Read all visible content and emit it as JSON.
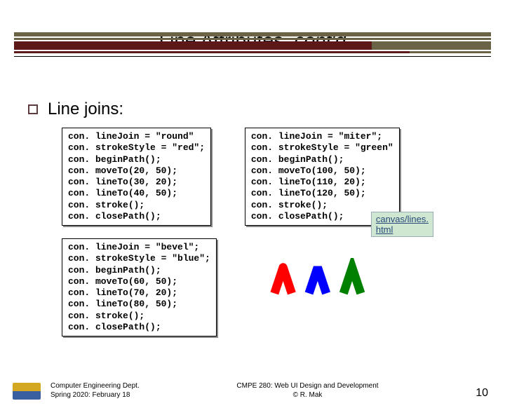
{
  "title": {
    "base": "Line Attributes, ",
    "italic": "cont'd"
  },
  "bullet": "Line joins:",
  "code": {
    "block1": "con. lineJoin = \"round\"\ncon. strokeStyle = \"red\";\ncon. beginPath();\ncon. moveTo(20, 50);\ncon. lineTo(30, 20);\ncon. lineTo(40, 50);\ncon. stroke();\ncon. closePath();",
    "block2": "con. lineJoin = \"bevel\";\ncon. strokeStyle = \"blue\";\ncon. beginPath();\ncon. moveTo(60, 50);\ncon. lineTo(70, 20);\ncon. lineTo(80, 50);\ncon. stroke();\ncon. closePath();",
    "block3": "con. lineJoin = \"miter\";\ncon. strokeStyle = \"green\"\ncon. beginPath();\ncon. moveTo(100, 50);\ncon. lineTo(110, 20);\ncon. lineTo(120, 50);\ncon. stroke();\ncon. closePath();"
  },
  "link_label": "canvas/lines. html",
  "chart_data": {
    "type": "line",
    "description": "Three caret shapes drawn with different lineJoin styles",
    "series": [
      {
        "name": "round",
        "color": "red",
        "points": [
          [
            20,
            50
          ],
          [
            30,
            20
          ],
          [
            40,
            50
          ]
        ]
      },
      {
        "name": "bevel",
        "color": "blue",
        "points": [
          [
            60,
            50
          ],
          [
            70,
            20
          ],
          [
            80,
            50
          ]
        ]
      },
      {
        "name": "miter",
        "color": "green",
        "points": [
          [
            100,
            50
          ],
          [
            110,
            20
          ],
          [
            120,
            50
          ]
        ]
      }
    ],
    "lineWidth": 10,
    "xlim": [
      10,
      130
    ],
    "ylim": [
      10,
      60
    ]
  },
  "footer": {
    "left1": "Computer Engineering Dept.",
    "left2": "Spring 2020: February 18",
    "mid1": "CMPE 280: Web UI Design and Development",
    "mid2": "© R. Mak",
    "page": "10"
  }
}
